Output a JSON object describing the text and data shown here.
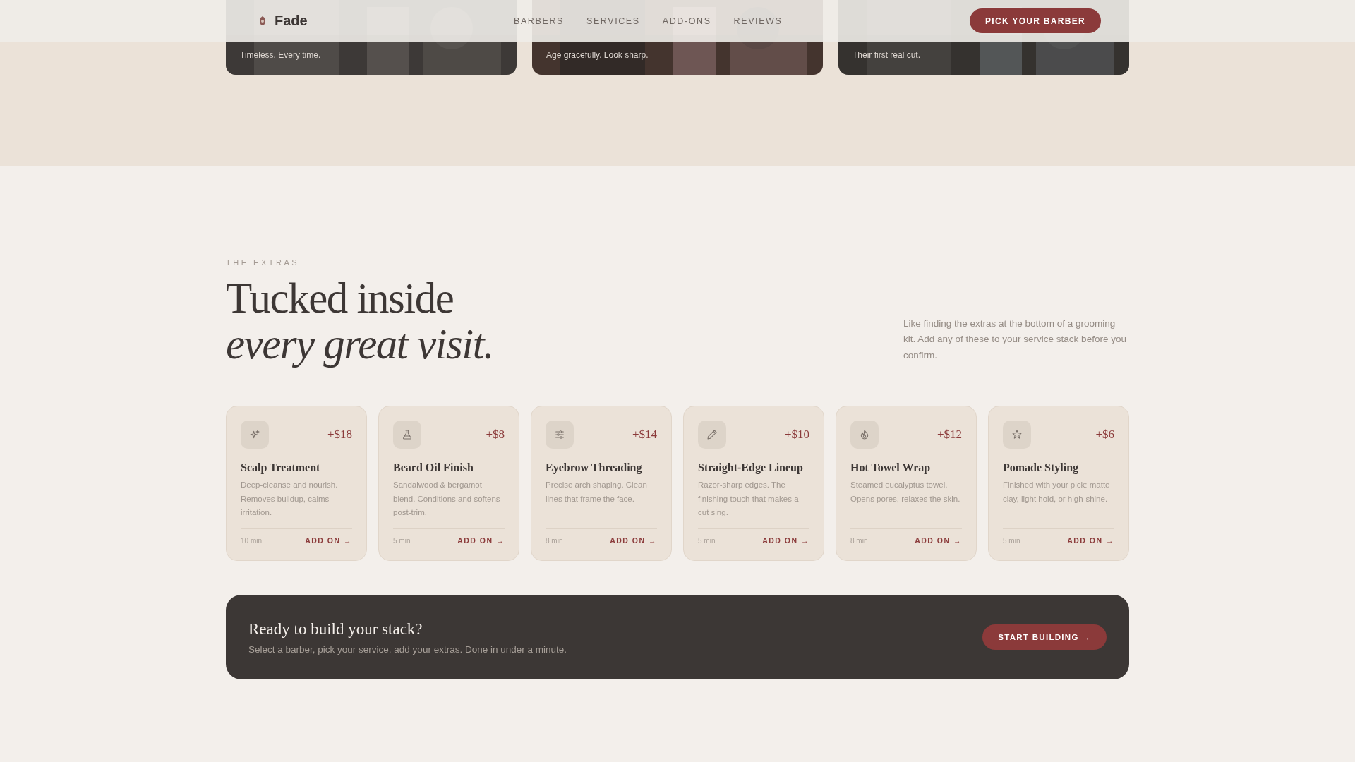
{
  "header": {
    "logo": "Fade",
    "nav": [
      {
        "label": "BARBERS"
      },
      {
        "label": "SERVICES"
      },
      {
        "label": "ADD-ONS"
      },
      {
        "label": "REVIEWS"
      }
    ],
    "cta": "PICK YOUR BARBER"
  },
  "feature_cards": [
    {
      "subtitle": "Timeless. Every time."
    },
    {
      "subtitle": "Age gracefully. Look sharp."
    },
    {
      "subtitle": "Their first real cut."
    }
  ],
  "extras": {
    "eyebrow": "THE EXTRAS",
    "heading_line_1": "Tucked inside",
    "heading_line_2": "every great visit.",
    "intro": "Like finding the extras at the bottom of a grooming kit. Add any of these to your service stack before you confirm.",
    "cards": [
      {
        "price": "+$18",
        "title": "Scalp Treatment",
        "description": "Deep-cleanse and nourish. Removes buildup, calms irritation.",
        "duration": "10 min",
        "action": "ADD ON →"
      },
      {
        "price": "+$8",
        "title": "Beard Oil Finish",
        "description": "Sandalwood & bergamot blend. Conditions and softens post-trim.",
        "duration": "5 min",
        "action": "ADD ON →"
      },
      {
        "price": "+$14",
        "title": "Eyebrow Threading",
        "description": "Precise arch shaping. Clean lines that frame the face.",
        "duration": "8 min",
        "action": "ADD ON →"
      },
      {
        "price": "+$10",
        "title": "Straight-Edge Lineup",
        "description": "Razor-sharp edges. The finishing touch that makes a cut sing.",
        "duration": "5 min",
        "action": "ADD ON →"
      },
      {
        "price": "+$12",
        "title": "Hot Towel Wrap",
        "description": "Steamed eucalyptus towel. Opens pores, relaxes the skin.",
        "duration": "8 min",
        "action": "ADD ON →"
      },
      {
        "price": "+$6",
        "title": "Pomade Styling",
        "description": "Finished with your pick: matte clay, light hold, or high-shine.",
        "duration": "5 min",
        "action": "ADD ON →"
      }
    ]
  },
  "cta_banner": {
    "title": "Ready to build your stack?",
    "text": "Select a barber, pick your service, add your extras. Done in under a minute.",
    "button": "START BUILDING →"
  }
}
